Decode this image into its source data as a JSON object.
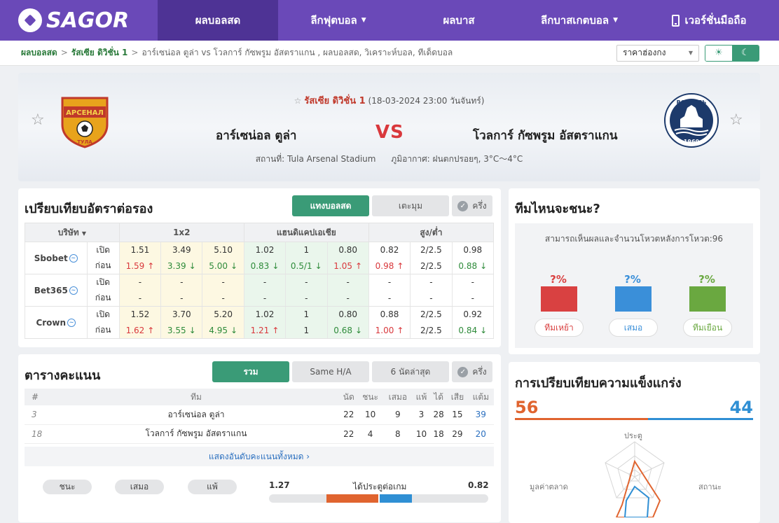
{
  "nav": {
    "logo": "SAGOR",
    "items": [
      {
        "label": "ผลบอลสด",
        "active": true
      },
      {
        "label": "ลีกฟุตบอล",
        "dropdown": true
      },
      {
        "label": "ผลบาส"
      },
      {
        "label": "ลีกบาสเกตบอล",
        "dropdown": true
      },
      {
        "label": "เวอร์ชั่นมือถือ",
        "icon": "phone-icon"
      }
    ]
  },
  "breadcrumb": {
    "items": [
      "ผลบอลสด",
      "รัสเซีย ดิวิชั่น 1"
    ],
    "tail": "อาร์เซน่อล ตูล่า vs โวลการ์ กัซพรูม อัสตราแกน ,  ผลบอลสด,  วิเคราะห์บอล,  ทีเด็ดบอล",
    "odds_select": "ราคาฮ่องกง"
  },
  "match": {
    "league": "รัสเซีย ดิวิชั่น 1",
    "datetime": "(18-03-2024 23:00 วันจันทร์)",
    "home": "อาร์เซน่อล ตูล่า",
    "away": "โวลการ์ กัซพรูม อัสตราแกน",
    "vs": "VS",
    "venue": "สถานที่: Tula Arsenal Stadium",
    "weather": "ภูมิอากาศ: ฝนตกปรอยๆ, 3°C～4°C",
    "home_crest_text": "АРСЕНАЛ",
    "home_crest_sub": "ТУЛА",
    "away_crest_text": "ВОЛГАРЬ",
    "away_crest_year": "1960"
  },
  "odds": {
    "title": "เปรียบเทียบอัตราต่อรอง",
    "tabs": [
      "แทงบอลสด",
      "เตะมุม",
      "ครึ่ง"
    ],
    "headers": {
      "company": "บริษัท",
      "g1": "1x2",
      "g2": "แฮนดิแคปเอเชีย",
      "g3": "สูง/ต่ำ"
    },
    "row_labels": {
      "open": "เปิด",
      "before": "ก่อน"
    },
    "companies": [
      {
        "name": "Sbobet",
        "open": [
          "1.51",
          "3.49",
          "5.10",
          "1.02",
          "1",
          "0.80",
          "0.82",
          "2/2.5",
          "0.98"
        ],
        "before": [
          "1.59",
          "3.39",
          "5.00",
          "0.83",
          "0.5/1",
          "1.05",
          "0.98",
          "2/2.5",
          "0.88"
        ],
        "dir": [
          "up",
          "down",
          "down",
          "down",
          "down",
          "up",
          "up",
          "",
          "down"
        ]
      },
      {
        "name": "Bet365",
        "open": [
          "-",
          "-",
          "-",
          "-",
          "-",
          "-",
          "-",
          "-",
          "-"
        ],
        "before": [
          "-",
          "-",
          "-",
          "-",
          "-",
          "-",
          "-",
          "-",
          "-"
        ],
        "dir": [
          "",
          "",
          "",
          "",
          "",
          "",
          "",
          "",
          ""
        ]
      },
      {
        "name": "Crown",
        "open": [
          "1.52",
          "3.70",
          "5.20",
          "1.02",
          "1",
          "0.80",
          "0.88",
          "2/2.5",
          "0.92"
        ],
        "before": [
          "1.62",
          "3.55",
          "4.95",
          "1.21",
          "1",
          "0.68",
          "1.00",
          "2/2.5",
          "0.84"
        ],
        "dir": [
          "up",
          "down",
          "down",
          "up",
          "",
          "down",
          "up",
          "",
          "down"
        ]
      }
    ]
  },
  "vote": {
    "title": "ทีมไหนจะชนะ?",
    "subtitle": "สามารถเห็นผลและจำนวนโหวตหลังการโหวต:96",
    "options": [
      {
        "pct": "?%",
        "label": "ทีมเหย้า",
        "color": "#d94141"
      },
      {
        "pct": "?%",
        "label": "เสมอ",
        "color": "#3a8fd9"
      },
      {
        "pct": "?%",
        "label": "ทีมเยือน",
        "color": "#6aa840"
      }
    ]
  },
  "standings": {
    "title": "ตารางคะแนน",
    "tabs": [
      "รวม",
      "Same H/A",
      "6 นัดล่าสุด",
      "ครึ่ง"
    ],
    "headers": [
      "#",
      "ทีม",
      "นัด",
      "ชนะ",
      "เสมอ",
      "แพ้",
      "ได้",
      "เสีย",
      "แต้ม"
    ],
    "rows": [
      [
        "3",
        "อาร์เซน่อล ตูล่า",
        "22",
        "10",
        "9",
        "3",
        "28",
        "15",
        "39"
      ],
      [
        "18",
        "โวลการ์ กัซพรูม อัสตราแกน",
        "22",
        "4",
        "8",
        "10",
        "18",
        "29",
        "20"
      ]
    ],
    "show_all": "แสดงอันดับคะแนนทั้งหมด",
    "pills": [
      "ชนะ",
      "เสมอ",
      "แพ้"
    ],
    "goals": {
      "label": "ได้ประตูต่อเกม",
      "home": "1.27",
      "away": "0.82"
    }
  },
  "strength": {
    "title": "การเปรียบเทียบความแข็งแกร่ง",
    "home": "56",
    "away": "44",
    "axes": [
      "ประตู",
      "สถานะ",
      "มูลค่าตลาด"
    ]
  },
  "colors": {
    "purple": "#6a49b8",
    "green": "#3a9b77",
    "home": "#e0642f",
    "away": "#2f8fd4"
  }
}
